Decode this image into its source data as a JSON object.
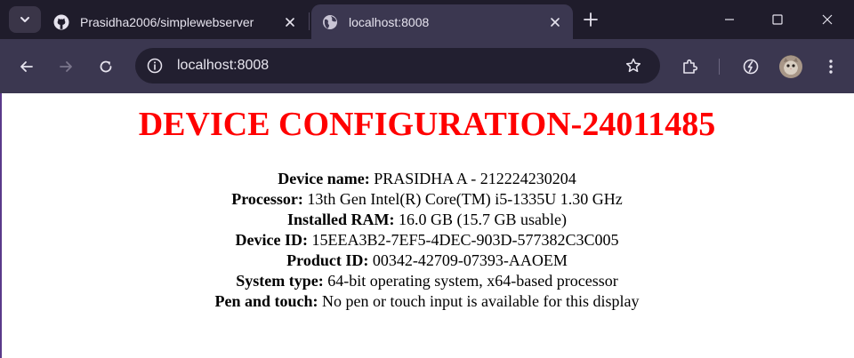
{
  "browser": {
    "tabs": [
      {
        "title": "Prasidha2006/simplewebserver",
        "active": false,
        "favicon": "github-icon"
      },
      {
        "title": "localhost:8008",
        "active": true,
        "favicon": "globe-icon"
      }
    ],
    "address": "localhost:8008"
  },
  "page": {
    "heading": "DEVICE CONFIGURATION-24011485",
    "heading_color": "#ff0000",
    "specs": [
      {
        "label": "Device name:",
        "value": "PRASIDHA A - 212224230204"
      },
      {
        "label": "Processor:",
        "value": "13th Gen Intel(R) Core(TM) i5-1335U 1.30 GHz"
      },
      {
        "label": "Installed RAM:",
        "value": "16.0 GB (15.7 GB usable)"
      },
      {
        "label": "Device ID:",
        "value": "15EEA3B2-7EF5-4DEC-903D-577382C3C005"
      },
      {
        "label": "Product ID:",
        "value": "00342-42709-07393-AAOEM"
      },
      {
        "label": "System type:",
        "value": "64-bit operating system, x64-based processor"
      },
      {
        "label": "Pen and touch:",
        "value": "No pen or touch input is available for this display"
      }
    ]
  }
}
